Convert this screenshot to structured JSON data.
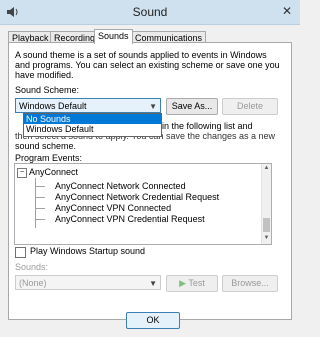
{
  "window": {
    "title": "Sound"
  },
  "tabs": [
    "Playback",
    "Recording",
    "Sounds",
    "Communications"
  ],
  "description": [
    "A sound theme is a set of sounds applied to events in Windows",
    "and programs.  You can select an existing scheme or save one you",
    "have modified."
  ],
  "scheme": {
    "label": "Sound Scheme:",
    "selected": "Windows Default",
    "options": [
      "No Sounds",
      "Windows Default"
    ],
    "save_as": "Save As...",
    "delete": "Delete"
  },
  "instruction": {
    "line1_visible": "ent in the following list and",
    "line2_partial": "then select a sound to apply. You can save the changes as a new",
    "line3": "sound scheme."
  },
  "program_events": {
    "label": "Program Events:",
    "group": "AnyConnect",
    "items": [
      "AnyConnect Network Connected",
      "AnyConnect Network Credential Request",
      "AnyConnect VPN Connected",
      "AnyConnect VPN Credential Request"
    ]
  },
  "startup": {
    "label": "Play Windows Startup sound",
    "checked": false
  },
  "sounds": {
    "label": "Sounds:",
    "value": "(None)",
    "test": "Test",
    "browse": "Browse..."
  },
  "footer": {
    "ok": "OK"
  }
}
